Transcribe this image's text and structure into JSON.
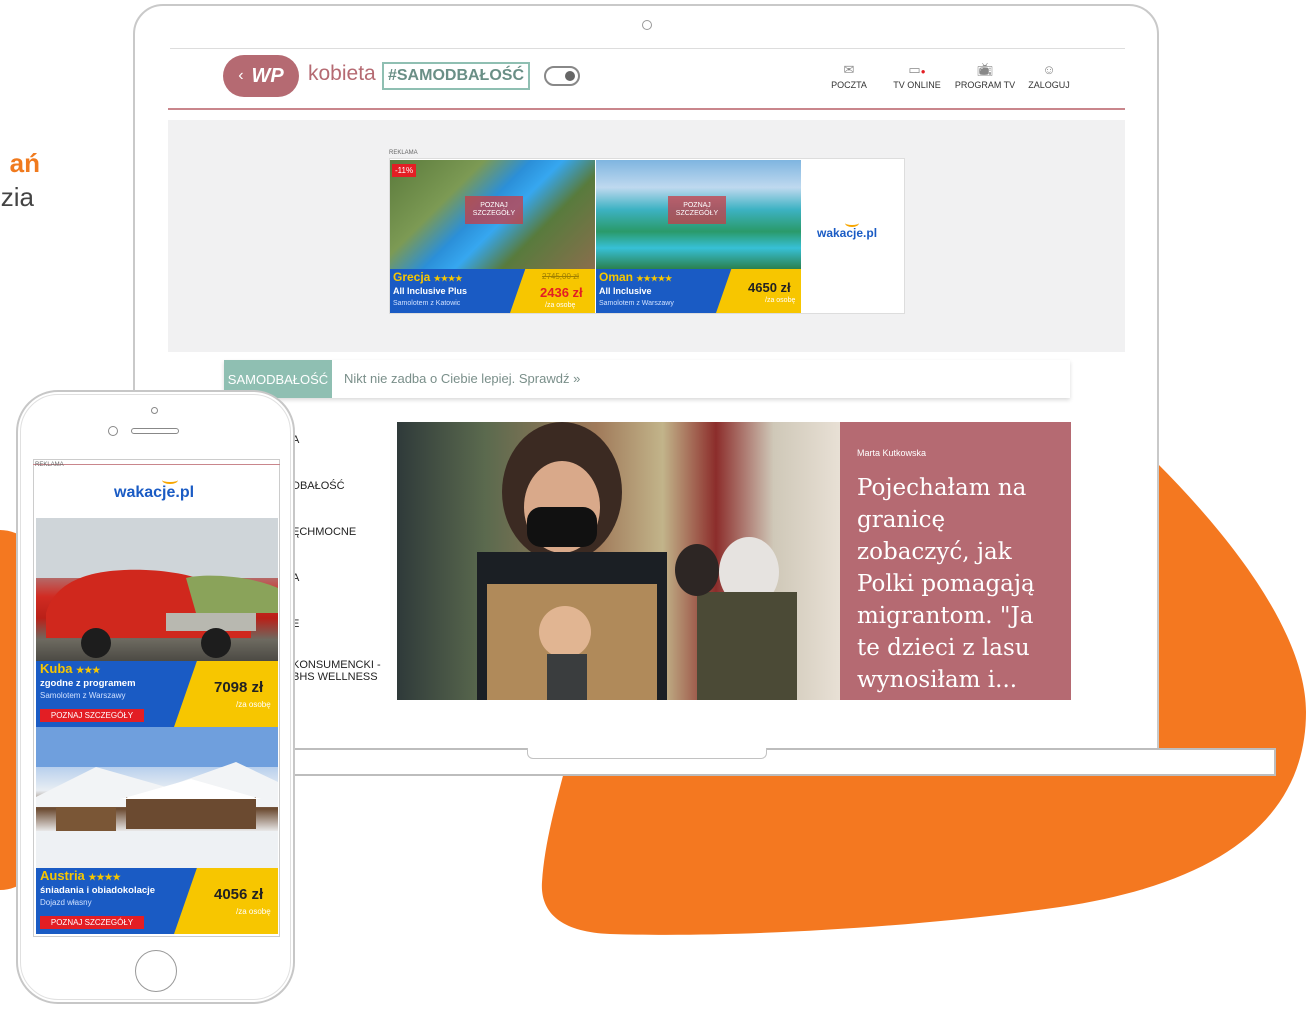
{
  "side_heading": {
    "line1": "ań",
    "line2": "zia"
  },
  "colors": {
    "accent_orange": "#F47820",
    "wp_rose": "#B56A72",
    "teal": "#8FBFB2",
    "deal_blue": "#1A5BC4",
    "deal_yellow": "#F7C600",
    "deal_red": "#E31E24"
  },
  "header": {
    "logo": "WP",
    "site": "kobieta",
    "tag": "#SAMODBAŁOŚĆ",
    "nav": [
      {
        "label": "POCZTA",
        "icon": "mail-icon"
      },
      {
        "label": "TV ONLINE",
        "icon": "tv-online-icon"
      },
      {
        "label": "PROGRAM TV",
        "icon": "tv-program-icon"
      },
      {
        "label": "ZALOGUJ",
        "icon": "user-icon"
      }
    ]
  },
  "desktop_ad": {
    "label": "REKLAMA",
    "brand": "wakacje.pl",
    "offers": [
      {
        "badge": "-11%",
        "cta": "POZNAJ SZCZEGÓŁY",
        "name": "Grecja",
        "stars": "★★★★",
        "plan": "All Inclusive Plus",
        "from": "Samolotem z Katowic",
        "old_price": "2745,00 zł",
        "price": "2436 zł",
        "per": "/za osobę"
      },
      {
        "cta": "POZNAJ SZCZEGÓŁY",
        "name": "Oman",
        "stars": "★★★★★",
        "plan": "All Inclusive",
        "from": "Samolotem z Warszawy",
        "price": "4650 zł",
        "per": "/za osobę"
      }
    ]
  },
  "section_bar": {
    "label": "SAMODBAŁOŚĆ",
    "text": "Nikt nie zadba o Ciebie lepiej. Sprawdź »"
  },
  "side_menu": [
    "A",
    "DBAŁOŚĆ",
    "ĘCHMOCNE",
    "A",
    "E",
    "KONSUMENCKI -",
    "BHS WELLNESS"
  ],
  "hero": {
    "author": "Marta Kutkowska",
    "title": "Pojechałam na granicę zobaczyć, jak Polki pomagają migrantom. \"Ja te dzieci z lasu wynosiłam i..."
  },
  "mobile_ad": {
    "label": "REKLAMA",
    "brand": "wakacje.pl",
    "offers": [
      {
        "name": "Kuba",
        "stars": "★★★",
        "plan": "zgodne z programem",
        "from": "Samolotem z Warszawy",
        "price": "7098 zł",
        "per": "/za osobę",
        "cta": "POZNAJ SZCZEGÓŁY"
      },
      {
        "name": "Austria",
        "stars": "★★★★",
        "plan": "śniadania i obiadokolacje",
        "from": "Dojazd własny",
        "price": "4056 zł",
        "per": "/za osobę",
        "cta": "POZNAJ SZCZEGÓŁY"
      }
    ]
  }
}
